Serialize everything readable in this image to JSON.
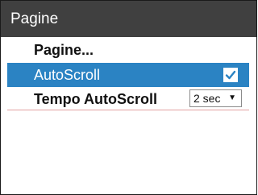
{
  "header": {
    "title": "Pagine"
  },
  "menu": {
    "pagine": {
      "label": "Pagine..."
    },
    "autoscroll": {
      "label": "AutoScroll",
      "checked": true
    },
    "tempo": {
      "label": "Tempo AutoScroll",
      "value": "2 sec"
    }
  },
  "colors": {
    "titlebar": "#404040",
    "selection": "#2b83c3",
    "divider": "#e2a0a0"
  }
}
